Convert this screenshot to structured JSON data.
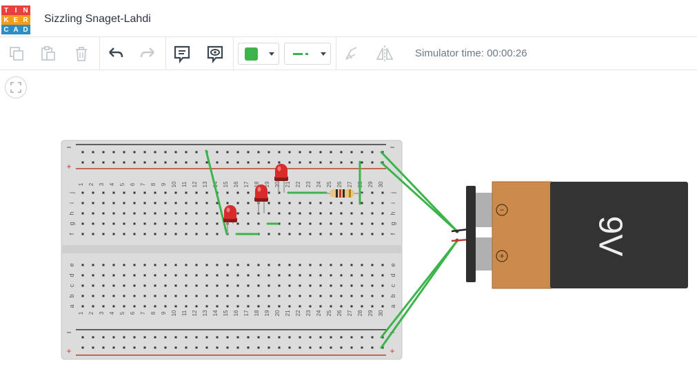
{
  "app": {
    "logo_letters": [
      "T",
      "I",
      "N",
      "K",
      "E",
      "R",
      "C",
      "A",
      "D"
    ],
    "logo_colors": [
      "#e8403b",
      "#e8403b",
      "#e8403b",
      "#f59c1c",
      "#f59c1c",
      "#f59c1c",
      "#2d8ec6",
      "#2d8ec6",
      "#2d8ec6"
    ],
    "project_title": "Sizzling Snaget-Lahdi"
  },
  "toolbar": {
    "copy_icon": "copy-icon",
    "paste_icon": "paste-icon",
    "delete_icon": "trash-icon",
    "undo_icon": "undo-icon",
    "redo_icon": "redo-icon",
    "notes_icon": "notes-icon",
    "visibility_icon": "eye-icon",
    "wire_color": "#3cb44b",
    "wire_type_icon": "wire-dash-icon",
    "rotate_icon": "rotate-icon",
    "flip_icon": "flip-icon",
    "simulator_time": "Simulator time: 00:00:26"
  },
  "canvas": {
    "fit_icon": "fit-view-icon",
    "breadboard": {
      "columns": [
        "1",
        "2",
        "3",
        "4",
        "5",
        "6",
        "7",
        "8",
        "9",
        "10",
        "11",
        "12",
        "13",
        "14",
        "15",
        "16",
        "17",
        "18",
        "19",
        "20",
        "21",
        "22",
        "23",
        "24",
        "25",
        "26",
        "27",
        "28",
        "29",
        "30"
      ],
      "top_rows": [
        "j",
        "i",
        "h",
        "g",
        "f"
      ],
      "bottom_rows": [
        "e",
        "d",
        "c",
        "b",
        "a"
      ],
      "rail_minus": "−",
      "rail_plus": "+"
    },
    "battery": {
      "label": "9V",
      "minus": "−",
      "plus": "+"
    }
  }
}
